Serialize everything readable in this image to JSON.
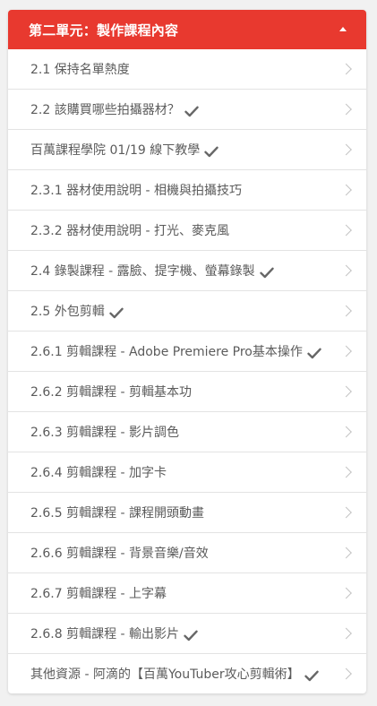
{
  "section": {
    "title": "第二單元：製作課程內容",
    "collapse_icon": "caret-up-icon",
    "accent_color": "#e8392f"
  },
  "lessons": [
    {
      "label": "2.1 保持名單熱度",
      "completed": false
    },
    {
      "label": "2.2 該購買哪些拍攝器材？",
      "completed": true
    },
    {
      "label": "百萬課程學院 01/19 線下教學",
      "completed": true
    },
    {
      "label": "2.3.1 器材使用說明 - 相機與拍攝技巧",
      "completed": false
    },
    {
      "label": "2.3.2 器材使用說明 - 打光、麥克風",
      "completed": false
    },
    {
      "label": "2.4 錄製課程 - 露臉、提字機、螢幕錄製",
      "completed": true
    },
    {
      "label": "2.5 外包剪輯",
      "completed": true
    },
    {
      "label": "2.6.1 剪輯課程 - Adobe Premiere Pro基本操作",
      "completed": true
    },
    {
      "label": "2.6.2 剪輯課程 - 剪輯基本功",
      "completed": false
    },
    {
      "label": "2.6.3 剪輯課程 - 影片調色",
      "completed": false
    },
    {
      "label": "2.6.4 剪輯課程 - 加字卡",
      "completed": false
    },
    {
      "label": "2.6.5 剪輯課程 - 課程開頭動畫",
      "completed": false
    },
    {
      "label": "2.6.6 剪輯課程 - 背景音樂/音效",
      "completed": false
    },
    {
      "label": "2.6.7 剪輯課程 - 上字幕",
      "completed": false
    },
    {
      "label": "2.6.8 剪輯課程 - 輸出影片",
      "completed": true
    },
    {
      "label": "其他資源 - 阿滴的【百萬YouTuber攻心剪輯術】",
      "completed": true
    }
  ]
}
